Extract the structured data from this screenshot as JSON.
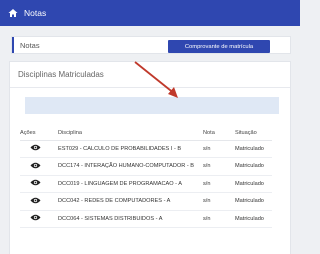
{
  "header": {
    "title": "Notas",
    "icon": "home-icon"
  },
  "breadcrumb": {
    "label": "Notas"
  },
  "panel": {
    "title": "Disciplinas Matriculadas",
    "button_label": "Comprovante de matrícula"
  },
  "table": {
    "columns": {
      "acoes": "Ações",
      "disciplina": "Disciplina",
      "nota": "Nota",
      "situacao": "Situação"
    },
    "rows": [
      {
        "disciplina": "EST029 - CALCULO DE PROBABILIDADES I - B",
        "nota": "s/n",
        "situacao": "Matriculado"
      },
      {
        "disciplina": "DCC174 - INTERAÇÃO HUMANO-COMPUTADOR - B",
        "nota": "s/n",
        "situacao": "Matriculado"
      },
      {
        "disciplina": "DCC019 - LINGUAGEM DE PROGRAMACAO - A",
        "nota": "s/n",
        "situacao": "Matriculado"
      },
      {
        "disciplina": "DCC042 - REDES DE COMPUTADORES - A",
        "nota": "s/n",
        "situacao": "Matriculado"
      },
      {
        "disciplina": "DCC064 - SISTEMAS DISTRIBUIDOS - A",
        "nota": "s/n",
        "situacao": "Matriculado"
      }
    ]
  },
  "colors": {
    "primary": "#2f47b0",
    "accent_arrow": "#c0392b",
    "toolbar_bg": "#dfe8f5"
  }
}
